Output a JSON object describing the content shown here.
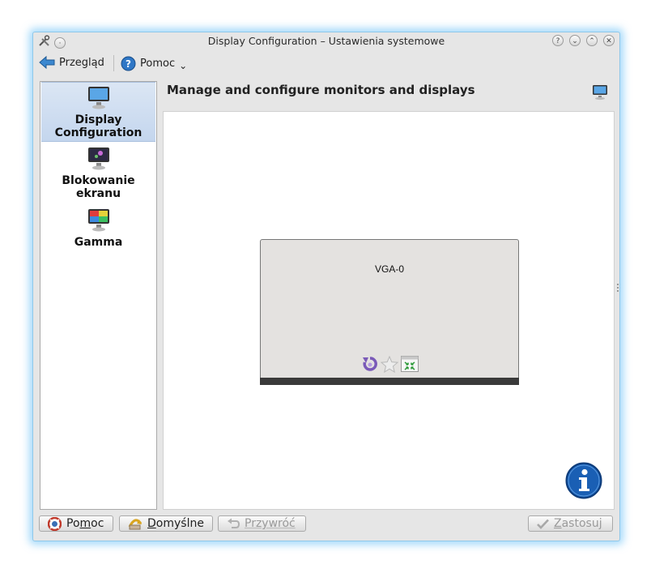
{
  "window": {
    "title": "Display Configuration – Ustawienia systemowe"
  },
  "toolbar": {
    "back_label": "Przegląd",
    "help_label": "Pomoc",
    "help_arrow": "⌄"
  },
  "sidebar": {
    "items": [
      {
        "label": "Display Configuration",
        "selected": true
      },
      {
        "label": "Blokowanie ekranu"
      },
      {
        "label": "Gamma"
      }
    ]
  },
  "content": {
    "heading": "Manage and configure monitors and displays"
  },
  "monitor": {
    "name": "VGA-0"
  },
  "buttons": {
    "help": {
      "pre": "Po",
      "key": "m",
      "post": "oc"
    },
    "defaults": {
      "key": "D",
      "post": "omyślne"
    },
    "reset": {
      "pre": "Przywróć"
    },
    "apply": {
      "key": "Z",
      "post": "astosuj"
    }
  },
  "colors": {
    "glow": "#5ab9f5",
    "selection": "#c4d6ee",
    "monitor_fill": "#e4e2e0",
    "info_blue": "#1a5fb4"
  },
  "titlebar_icons": [
    "tools-icon",
    "pin-icon",
    "help-icon",
    "minimize-icon",
    "maximize-icon",
    "close-icon"
  ]
}
